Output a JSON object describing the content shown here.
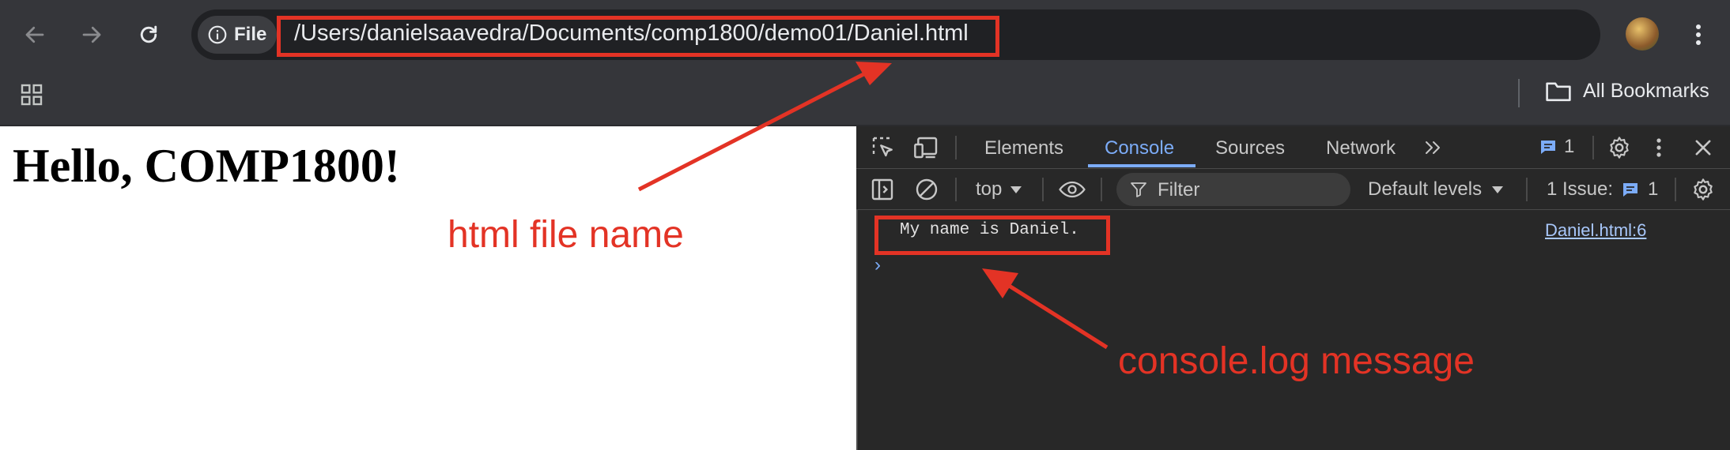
{
  "toolbar": {
    "back_icon": "arrow-left-icon",
    "forward_icon": "arrow-right-icon",
    "reload_icon": "reload-icon",
    "site_info_label": "File",
    "url": "/Users/danielsaavedra/Documents/comp1800/demo01/Daniel.html",
    "bookmark_icon": "star-icon",
    "menu_icon": "kebab-menu-icon"
  },
  "bookmarks_bar": {
    "all_bookmarks_label": "All Bookmarks"
  },
  "page": {
    "heading": "Hello, COMP1800!"
  },
  "devtools": {
    "tabs": [
      {
        "label": "Elements"
      },
      {
        "label": "Console"
      },
      {
        "label": "Sources"
      },
      {
        "label": "Network"
      }
    ],
    "active_tab": "Console",
    "messages_count": "1",
    "console_toolbar": {
      "context": "top",
      "filter_placeholder": "Filter",
      "levels": "Default levels",
      "issues_label": "1 Issue:",
      "issues_count": "1"
    },
    "console": {
      "message": "My name is Daniel.",
      "source": "Daniel.html:6"
    }
  },
  "annotations": {
    "file_name_label": "html file name",
    "console_label": "console.log message",
    "color": "#e33325"
  },
  "colors": {
    "chrome_bg": "#35363a",
    "omnibox_bg": "#202124",
    "devtools_bg": "#282828",
    "accent": "#7cacf8"
  }
}
